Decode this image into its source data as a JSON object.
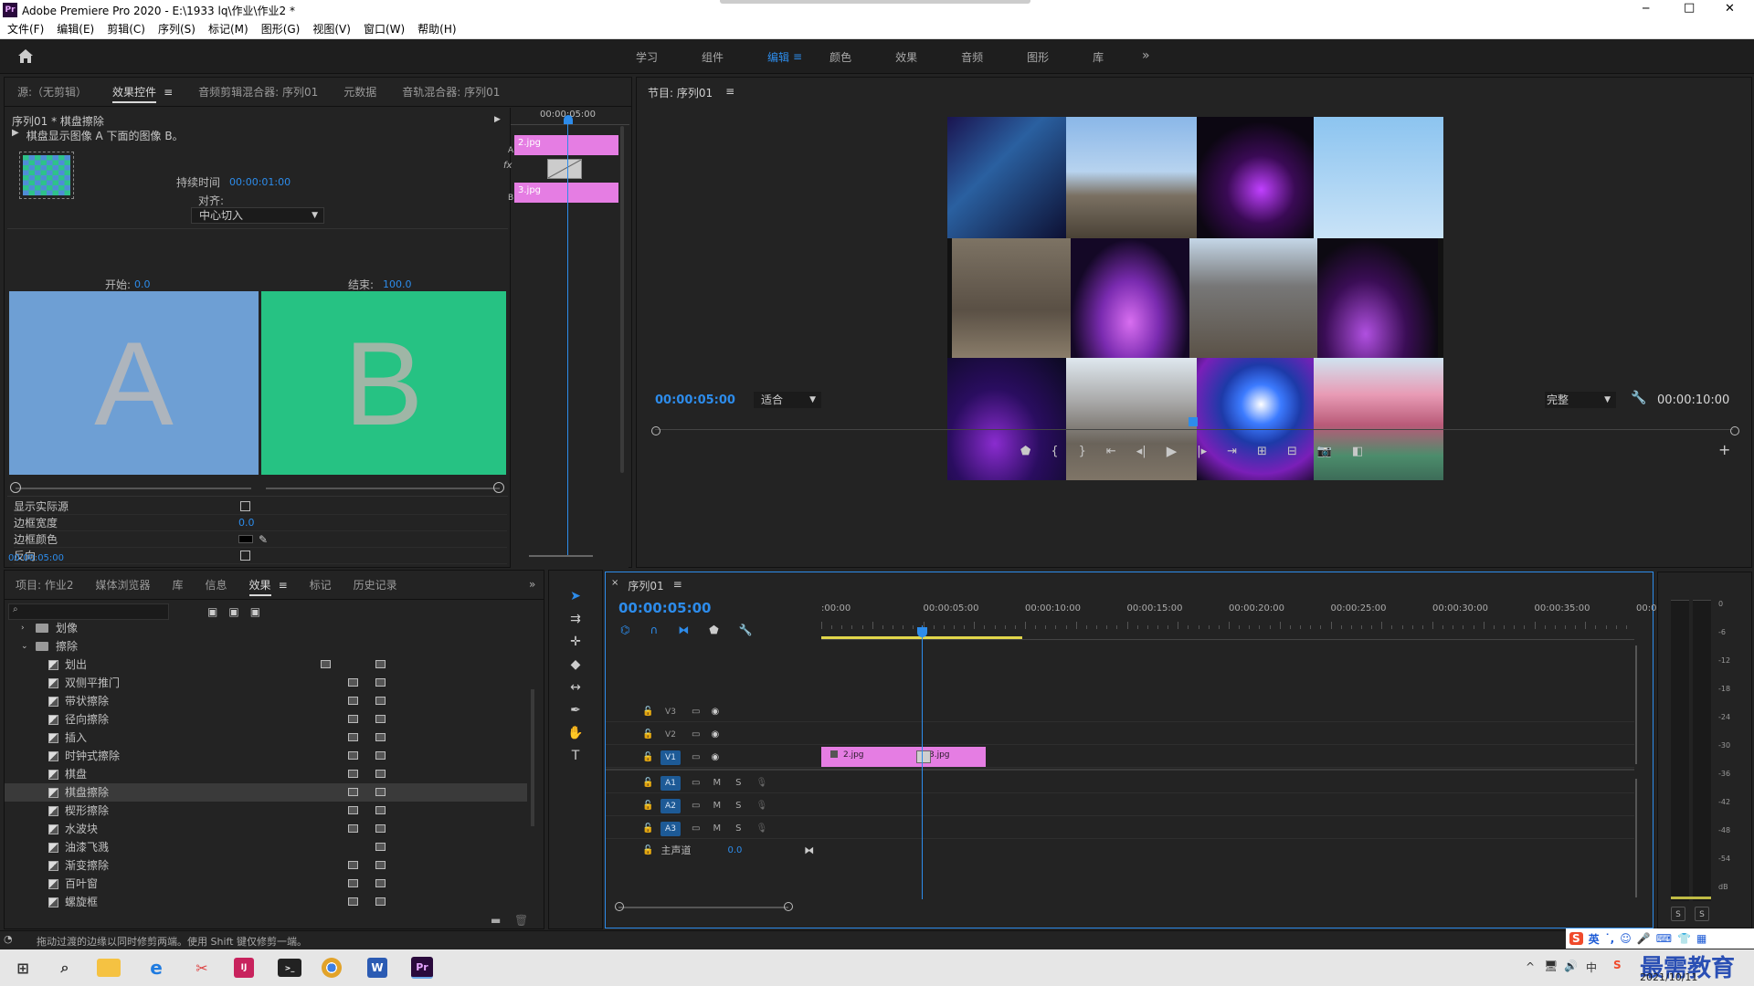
{
  "window": {
    "title": "Adobe Premiere Pro 2020 - E:\\1933 lq\\作业\\作业2 *",
    "app_badge": "Pr",
    "min": "─",
    "max": "□",
    "close": "✕"
  },
  "menu": [
    "文件(F)",
    "编辑(E)",
    "剪辑(C)",
    "序列(S)",
    "标记(M)",
    "图形(G)",
    "视图(V)",
    "窗口(W)",
    "帮助(H)"
  ],
  "workspaces": {
    "items": [
      "学习",
      "组件",
      "编辑",
      "颜色",
      "效果",
      "音频",
      "图形",
      "库"
    ],
    "active": "编辑",
    "more": "»"
  },
  "source_panel": {
    "tabs": [
      "源:（无剪辑）",
      "效果控件",
      "音频剪辑混合器: 序列01",
      "元数据",
      "音轨混合器: 序列01"
    ],
    "active_tab": "效果控件",
    "clip_path": "序列01 * 棋盘擦除",
    "description": "棋盘显示图像 A 下面的图像 B。",
    "duration_label": "持续时间",
    "duration_value": "00:00:01:00",
    "align_label": "对齐:",
    "align_value": "中心切入",
    "start_label": "开始:",
    "start_value": "0.0",
    "end_label": "结束:",
    "end_value": "100.0",
    "preview_a": "A",
    "preview_b": "B",
    "props": [
      {
        "label": "显示实际源",
        "type": "checkbox"
      },
      {
        "label": "边框宽度",
        "value": "0.0"
      },
      {
        "label": "边框颜色",
        "type": "color"
      },
      {
        "label": "反向",
        "type": "checkbox"
      }
    ],
    "mini_timecode": "00:00:05:00",
    "mini_ruler": "00:00:05:00",
    "mini_clip_a": "2.jpg",
    "mini_clip_b": "3.jpg",
    "label_a": "A",
    "label_b": "B",
    "fx": "fx",
    "timecode": "00:00:05:00"
  },
  "program_panel": {
    "title": "节目: 序列01",
    "timecode_left": "00:00:05:00",
    "fit": "适合",
    "quality": "完整",
    "timecode_right": "00:00:10:00"
  },
  "project_panel": {
    "tabs": [
      "项目: 作业2",
      "媒体浏览器",
      "库",
      "信息",
      "效果",
      "标记",
      "历史记录"
    ],
    "active_tab": "效果",
    "folders": [
      {
        "label": "划像",
        "open": false
      },
      {
        "label": "擦除",
        "open": true
      }
    ],
    "items": [
      "划出",
      "双侧平推门",
      "带状擦除",
      "径向擦除",
      "插入",
      "时钟式擦除",
      "棋盘",
      "棋盘擦除",
      "楔形擦除",
      "水波块",
      "油漆飞溅",
      "渐变擦除",
      "百叶窗",
      "螺旋框"
    ],
    "selected": "棋盘擦除"
  },
  "timeline": {
    "title": "序列01",
    "timecode": "00:00:05:00",
    "ruler": [
      ":00:00",
      "00:00:05:00",
      "00:00:10:00",
      "00:00:15:00",
      "00:00:20:00",
      "00:00:25:00",
      "00:00:30:00",
      "00:00:35:00",
      "00:00"
    ],
    "video_tracks": [
      "V3",
      "V2",
      "V1"
    ],
    "audio_tracks": [
      "A1",
      "A2",
      "A3"
    ],
    "master_label": "主声道",
    "master_value": "0.0",
    "clips": [
      {
        "name": "2.jpg"
      },
      {
        "name": "3.jpg"
      }
    ],
    "m": "M",
    "s": "S"
  },
  "meter": {
    "scale": [
      "0",
      "-6",
      "-12",
      "-18",
      "-24",
      "-30",
      "-36",
      "-42",
      "-48",
      "-54",
      "dB"
    ],
    "s1": "S",
    "s2": "S"
  },
  "status_bar": "拖动过渡的边缘以同时修剪两端。使用 Shift 键仅修剪一端。",
  "tray": {
    "ime": "英",
    "date": "2021/10/11",
    "watermark": "最需教育"
  },
  "colors": {
    "accent": "#2d8ceb",
    "clip_pink": "#e57de3",
    "panel": "#232323",
    "preview_a": "#6e9fd4",
    "preview_b": "#26c283"
  }
}
